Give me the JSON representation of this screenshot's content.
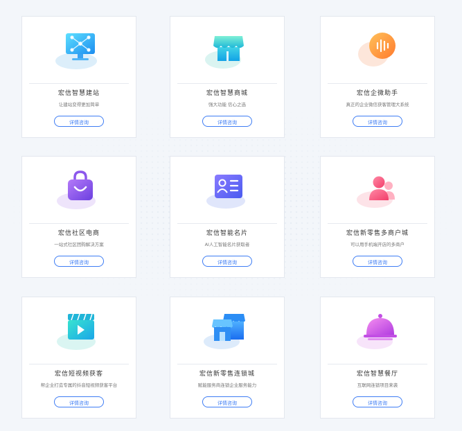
{
  "cards": [
    {
      "title": "宏信智慧建站",
      "desc": "让建站变得更加简单",
      "button": "详情咨询"
    },
    {
      "title": "宏信智慧商城",
      "desc": "强大功能 信心之选",
      "button": "详情咨询"
    },
    {
      "title": "宏信企微助手",
      "desc": "真正的企业微信获客管理大系统",
      "button": "详情咨询"
    },
    {
      "title": "宏信社区电商",
      "desc": "一站式社区团购解决方案",
      "button": "详情咨询"
    },
    {
      "title": "宏信智能名片",
      "desc": "AI人工智能名片获取者",
      "button": "详情咨询"
    },
    {
      "title": "宏信新零售多商户城",
      "desc": "可以用手机端开店的多商户",
      "button": "详情咨询"
    },
    {
      "title": "宏信短视频获客",
      "desc": "帮企业打造专属的抖音短视频获客平台",
      "button": "详情咨询"
    },
    {
      "title": "宏信新零售连锁城",
      "desc": "赋能服务商连锁企业服务能力",
      "button": "详情咨询"
    },
    {
      "title": "宏信智慧餐厅",
      "desc": "互联网连锁项目来袭",
      "button": "详情咨询"
    }
  ],
  "icons": [
    "monitor-network-icon",
    "storefront-icon",
    "chat-voice-icon",
    "shopping-bag-icon",
    "business-card-icon",
    "user-group-icon",
    "video-play-icon",
    "chain-store-icon",
    "food-cloche-icon"
  ]
}
